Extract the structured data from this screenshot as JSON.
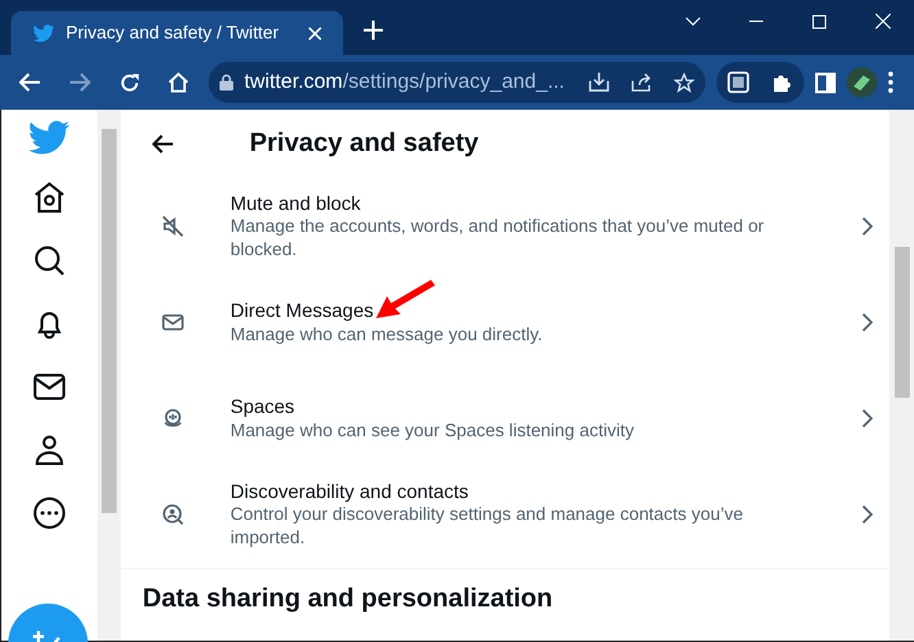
{
  "browser": {
    "tab": {
      "title": "Privacy and safety / Twitter",
      "selected": true
    },
    "address": {
      "host": "twitter.com",
      "path": "/settings/privacy_and_..."
    }
  },
  "page": {
    "title": "Privacy and safety",
    "items": [
      {
        "kind": "mute",
        "title": "Mute and block",
        "description": "Manage the accounts, words, and notifications that you’ve muted or blocked.",
        "pointed": false
      },
      {
        "kind": "messages",
        "title": "Direct Messages",
        "description": "Manage who can message you directly.",
        "pointed": true
      },
      {
        "kind": "spaces",
        "title": "Spaces",
        "description": "Manage who can see your Spaces listening activity",
        "pointed": false
      },
      {
        "kind": "discover",
        "title": "Discoverability and contacts",
        "description": "Control your discoverability settings and manage contacts you’ve imported.",
        "pointed": false
      }
    ],
    "section_heading": "Data sharing and personalization"
  }
}
